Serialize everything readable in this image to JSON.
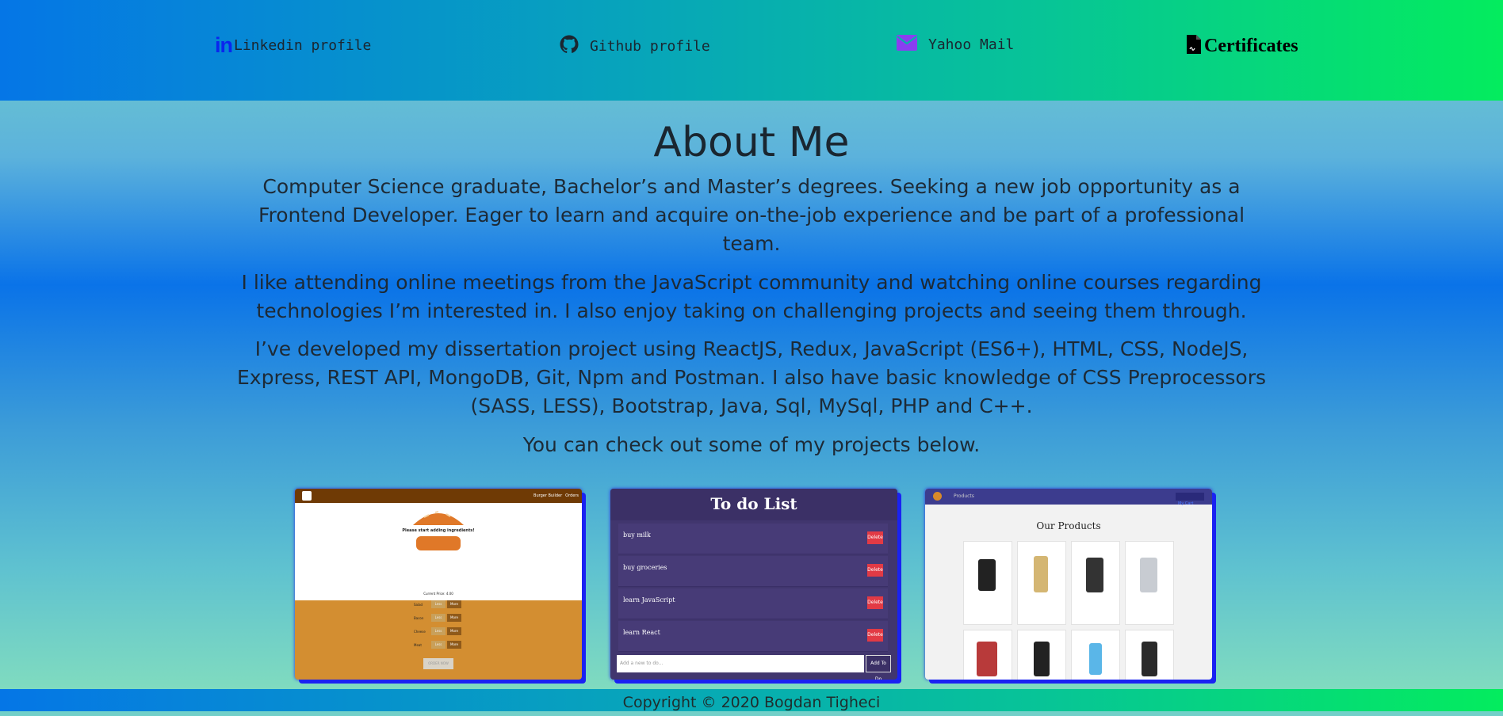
{
  "nav": {
    "linkedin": {
      "icon": "in",
      "label": "Linkedin profile"
    },
    "github": {
      "label": "Github profile"
    },
    "mail": {
      "label": "Yahoo Mail"
    },
    "certificates": {
      "label": "Certificates"
    }
  },
  "about": {
    "title": "About Me",
    "paragraphs": [
      "Computer Science graduate, Bachelor’s and Master’s degrees. Seeking a new job opportunity as a Frontend Developer. Eager to learn and acquire on-the-job experience and be part of a professional team.",
      "I like attending online meetings from the JavaScript community and watching online courses regarding technologies I’m interested in. I also enjoy taking on challenging projects and seeing them through.",
      "I’ve developed my dissertation project using ReactJS, Redux, JavaScript (ES6+), HTML, CSS, NodeJS, Express, REST API, MongoDB, Git, Npm and Postman. I also have basic knowledge of CSS Preprocessors (SASS, LESS), Bootstrap, Java, Sql, MySql, PHP and C++.",
      "You can check out some of my projects below."
    ]
  },
  "projects": {
    "burger": {
      "nav": [
        "Burger Builder",
        "Orders"
      ],
      "message": "Please start adding ingredients!",
      "price": "Current Price: 4.00",
      "ingredients": [
        "Salad",
        "Bacon",
        "Cheese",
        "Meat"
      ],
      "less": "Less",
      "more": "More",
      "order": "ORDER NOW"
    },
    "todo": {
      "title": "To do List",
      "items": [
        "buy milk",
        "buy groceries",
        "learn JavaScript",
        "learn React"
      ],
      "delete": "Delete",
      "input_placeholder": "Add a new to do...",
      "add": "Add To Do"
    },
    "shop": {
      "nav": "Products",
      "cart": "My Cart",
      "heading": "Our Products"
    }
  },
  "footer": {
    "text": "Copyright © 2020 Bogdan Tigheci"
  },
  "colors": {
    "accent_blue": "#0a26ee",
    "mail_purple": "#8a3ef0",
    "shadow_blue": "#1a22f2"
  }
}
